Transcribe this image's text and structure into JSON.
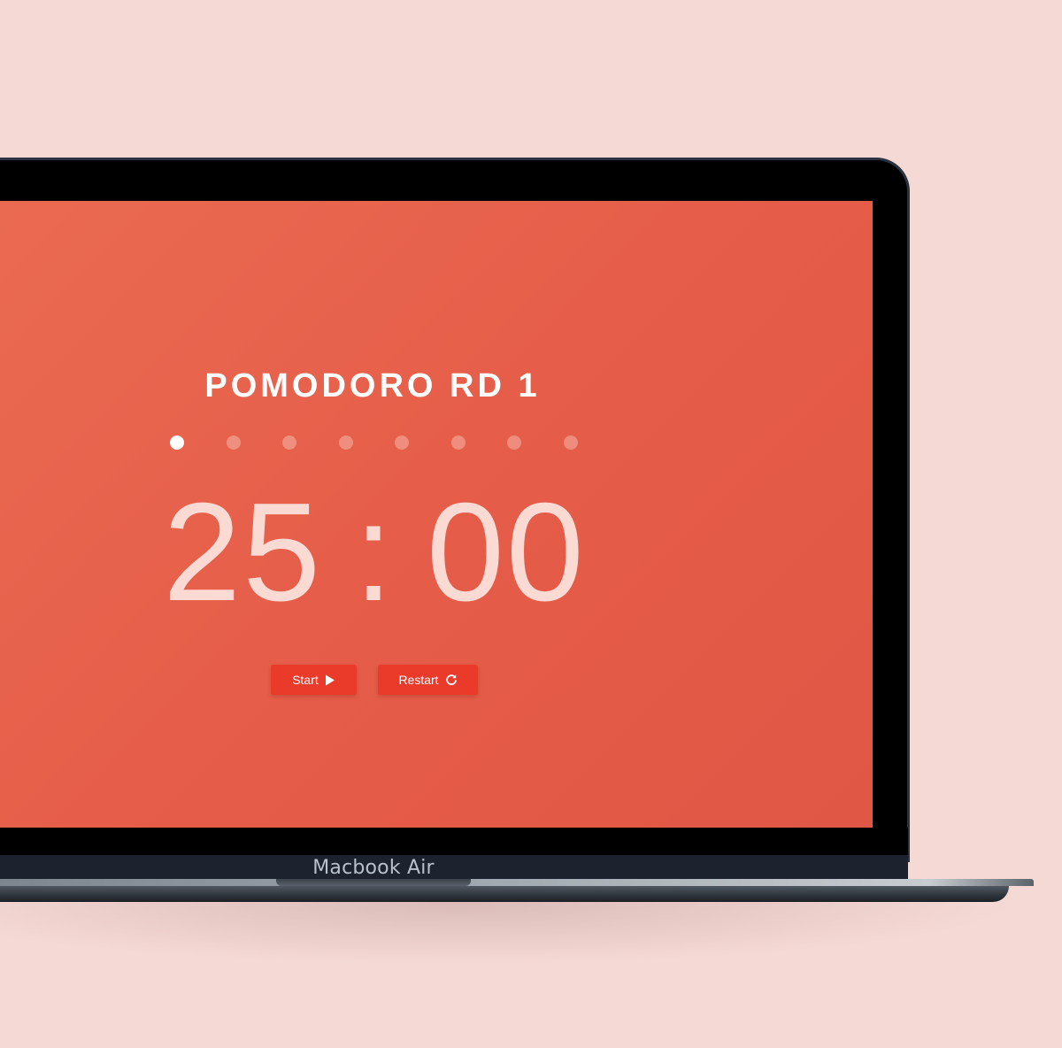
{
  "device": {
    "brand_label": "Macbook Air"
  },
  "app": {
    "title": "POMODORO RD 1",
    "rounds_total": 8,
    "current_round": 1,
    "timer": {
      "minutes": "25",
      "separator": ":",
      "seconds": "00"
    },
    "buttons": {
      "start_label": "Start",
      "start_icon": "play-icon",
      "restart_label": "Restart",
      "restart_icon": "restart-icon"
    }
  },
  "colors": {
    "background": "#f5d9d5",
    "screen_accent": "#e55c48",
    "button": "#e93a2a",
    "timer_text": "#fbdad4"
  }
}
